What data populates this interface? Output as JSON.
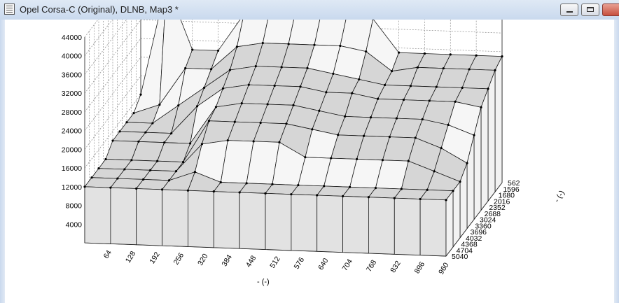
{
  "window": {
    "title": "Opel Corsa-C (Original), DLNB, Map3 *",
    "icon": "map-document-icon",
    "controls": {
      "minimize": "minimize-icon",
      "maximize": "maximize-icon",
      "close": "close-icon"
    }
  },
  "plot": {
    "z_ticks": [
      "4000",
      "8000",
      "12000",
      "16000",
      "20000",
      "24000",
      "28000",
      "32000",
      "36000",
      "40000",
      "44000"
    ],
    "x_ticks": [
      "64",
      "128",
      "192",
      "256",
      "320",
      "384",
      "448",
      "512",
      "576",
      "640",
      "704",
      "768",
      "832",
      "896",
      "960"
    ],
    "y_ticks": [
      "562",
      "1596",
      "1680",
      "2016",
      "2352",
      "2688",
      "3024",
      "3360",
      "3696",
      "4032",
      "4368",
      "4704",
      "5040"
    ],
    "x_axis_label": "-  (-)",
    "y_axis_label": "-  (-)"
  },
  "chart_data": {
    "type": "surface-3d",
    "x_axis_label": "-  (-)",
    "y_axis_label": "-  (-)",
    "z_range": [
      0,
      44000
    ],
    "grid": true,
    "surface_rows": [
      [
        16000,
        40000,
        26000,
        26000,
        34000,
        35000,
        35000,
        35000,
        35000,
        34000,
        27000,
        27000,
        27000,
        27000,
        27000
      ],
      [
        14000,
        16000,
        24000,
        24000,
        29000,
        30000,
        30000,
        30000,
        30000,
        29000,
        25000,
        26000,
        26000,
        26000,
        26000
      ],
      [
        14000,
        14000,
        18000,
        22000,
        26000,
        27000,
        27000,
        27000,
        26000,
        25000,
        24000,
        24000,
        24000,
        24000,
        24000
      ],
      [
        14000,
        14000,
        14000,
        20000,
        24000,
        25000,
        25000,
        25000,
        24000,
        24000,
        23000,
        23000,
        23000,
        23000,
        22000
      ],
      [
        14000,
        14000,
        14000,
        14000,
        22000,
        23000,
        23000,
        23000,
        22000,
        21000,
        21000,
        21000,
        21000,
        20000,
        18000
      ],
      [
        12000,
        12000,
        12000,
        12000,
        21000,
        21000,
        21000,
        21000,
        20000,
        19000,
        19000,
        19000,
        19000,
        17000,
        14000
      ],
      [
        12000,
        12000,
        12000,
        12000,
        18000,
        19000,
        19000,
        19000,
        16000,
        16000,
        16000,
        16000,
        16000,
        14000,
        12000
      ],
      [
        12000,
        12000,
        12000,
        12000,
        14000,
        12000,
        12000,
        12000,
        12000,
        12000,
        12000,
        12000,
        12000,
        12000,
        12000
      ],
      [
        12000,
        12000,
        12000,
        12000,
        12000,
        12000,
        12000,
        12000,
        12000,
        12000,
        12000,
        12000,
        12000,
        12000,
        12000
      ]
    ]
  }
}
